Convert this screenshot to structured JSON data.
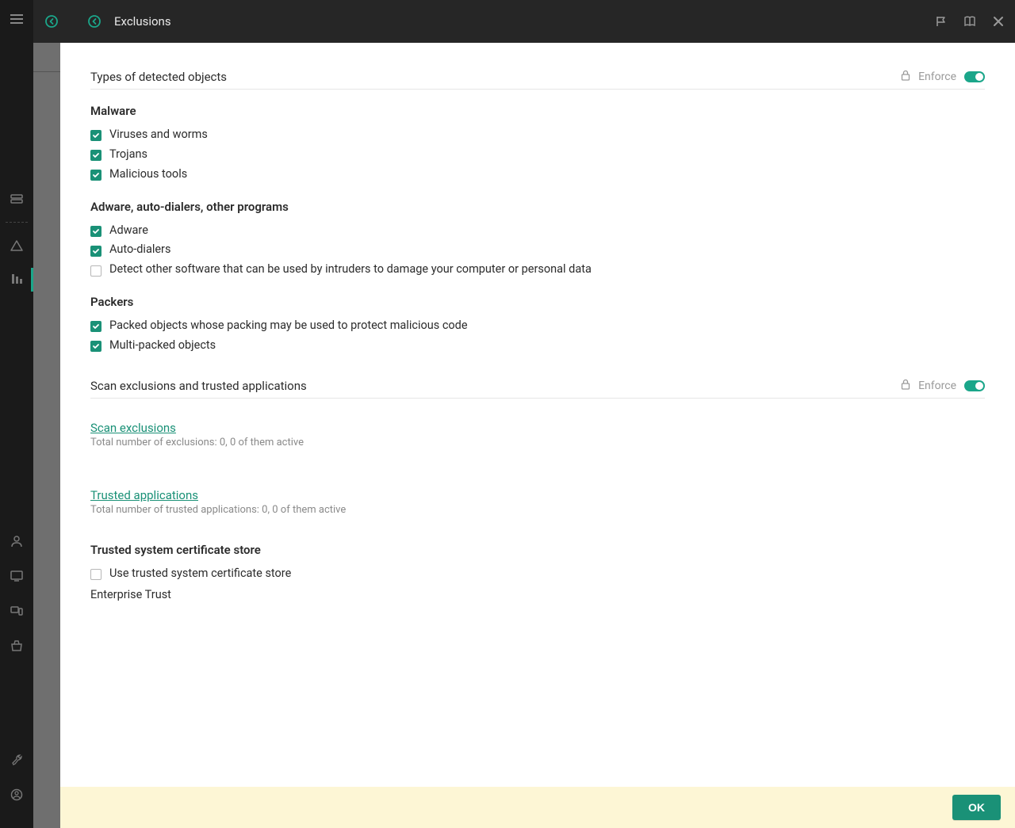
{
  "header": {
    "title": "Exclusions"
  },
  "sections": {
    "types": {
      "title": "Types of detected objects",
      "enforce_label": "Enforce",
      "groups": {
        "malware": {
          "title": "Malware",
          "items": [
            {
              "label": "Viruses and worms",
              "checked": true
            },
            {
              "label": "Trojans",
              "checked": true
            },
            {
              "label": "Malicious tools",
              "checked": true
            }
          ]
        },
        "adware": {
          "title": "Adware, auto-dialers, other programs",
          "items": [
            {
              "label": "Adware",
              "checked": true
            },
            {
              "label": "Auto-dialers",
              "checked": true
            },
            {
              "label": "Detect other software that can be used by intruders to damage your computer or personal data",
              "checked": false
            }
          ]
        },
        "packers": {
          "title": "Packers",
          "items": [
            {
              "label": "Packed objects whose packing may be used to protect malicious code",
              "checked": true
            },
            {
              "label": "Multi-packed objects",
              "checked": true
            }
          ]
        }
      }
    },
    "scan_trusted": {
      "title": "Scan exclusions and trusted applications",
      "enforce_label": "Enforce",
      "scan_exclusions": {
        "link": "Scan exclusions",
        "subtext": "Total number of exclusions: 0, 0 of them active"
      },
      "trusted_apps": {
        "link": "Trusted applications",
        "subtext": "Total number of trusted applications: 0, 0 of them active"
      }
    },
    "cert_store": {
      "title": "Trusted system certificate store",
      "checkbox_label": "Use trusted system certificate store",
      "checkbox_checked": false,
      "value": "Enterprise Trust"
    }
  },
  "footer": {
    "ok": "OK"
  }
}
